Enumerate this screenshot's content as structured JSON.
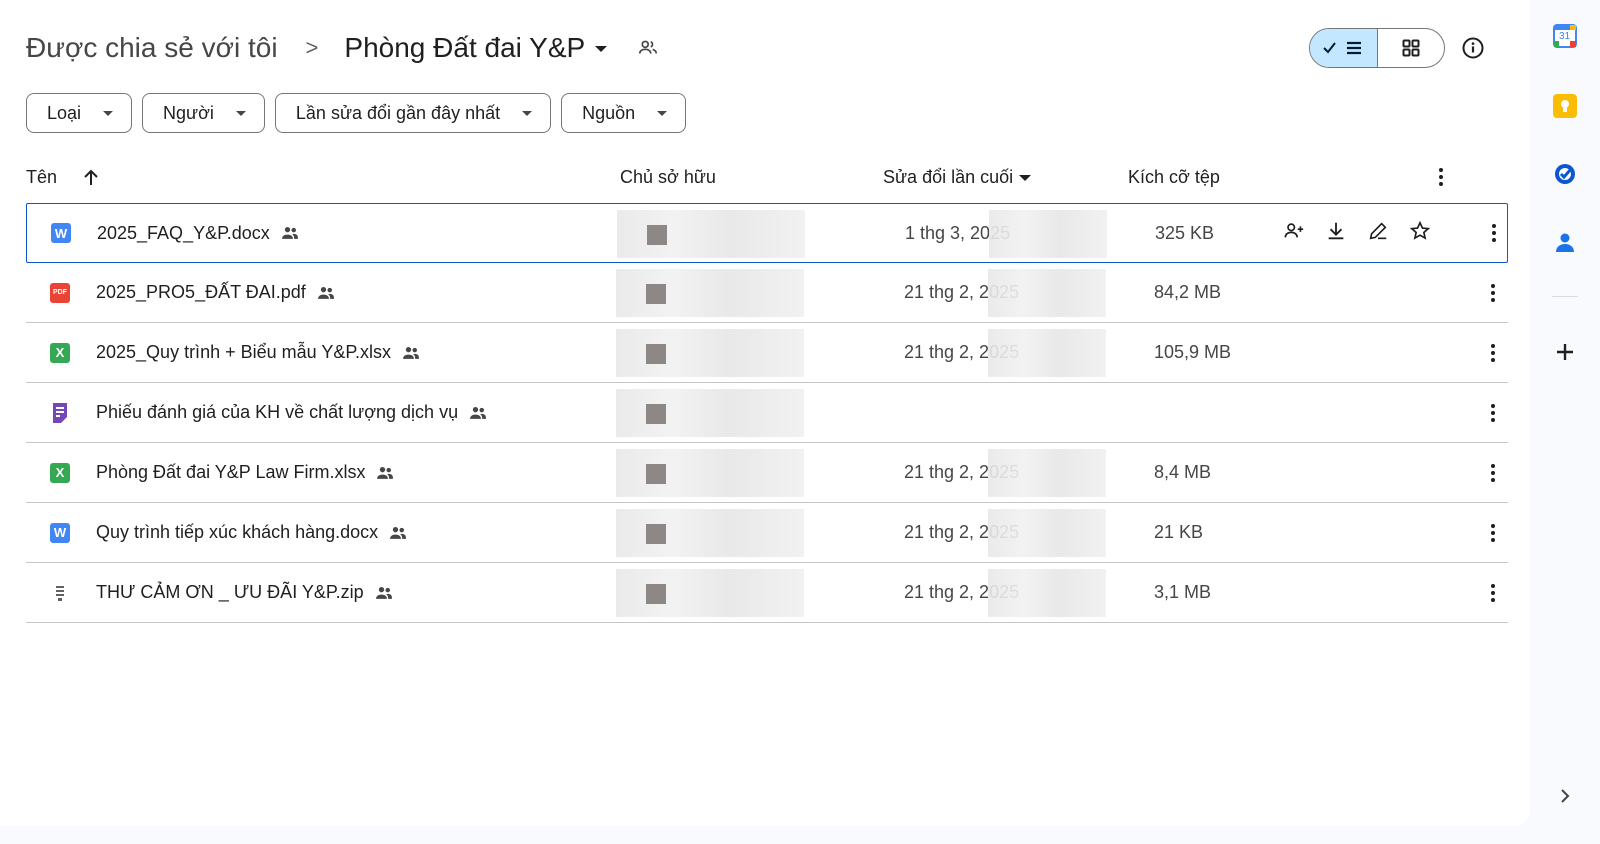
{
  "breadcrumb": {
    "root": "Được chia sẻ với tôi",
    "separator": ">",
    "current": "Phòng Đất đai Y&P"
  },
  "filters": [
    {
      "label": "Loại"
    },
    {
      "label": "Người"
    },
    {
      "label": "Lần sửa đổi gần đây nhất"
    },
    {
      "label": "Nguồn"
    }
  ],
  "table": {
    "headers": {
      "name": "Tên",
      "owner": "Chủ sở hữu",
      "modified": "Sửa đổi lần cuối",
      "size": "Kích cỡ tệp"
    },
    "rows": [
      {
        "icon": "word",
        "icon_text": "W",
        "name": "2025_FAQ_Y&P.docx",
        "date": "1 thg 3, 2025",
        "size": "325 KB",
        "selected": true
      },
      {
        "icon": "pdf",
        "icon_text": "PDF",
        "name": "2025_PRO5_ĐẤT ĐAI.pdf",
        "date": "21 thg 2, 2025",
        "size": "84,2 MB"
      },
      {
        "icon": "xls",
        "icon_text": "X",
        "name": "2025_Quy trình + Biểu mẫu Y&P.xlsx",
        "date": "21 thg 2, 2025",
        "size": "105,9 MB"
      },
      {
        "icon": "form",
        "icon_text": "",
        "name": "Phiếu đánh giá của KH về chất lượng dịch vụ",
        "date": "",
        "size": ""
      },
      {
        "icon": "xls",
        "icon_text": "X",
        "name": "Phòng Đất đai Y&P Law Firm.xlsx",
        "date": "21 thg 2, 2025",
        "size": "8,4 MB"
      },
      {
        "icon": "word",
        "icon_text": "W",
        "name": "Quy trình tiếp xúc khách hàng.docx",
        "date": "21 thg 2, 2025",
        "size": "21 KB"
      },
      {
        "icon": "zip",
        "icon_text": "",
        "name": "THƯ CẢM ƠN _ ƯU ĐÃI Y&P.zip",
        "date": "21 thg 2, 2025",
        "size": "3,1 MB"
      }
    ]
  },
  "colors": {
    "accent_blue": "#0b57d0",
    "toggle_active": "#c2e7ff",
    "word": "#4285f4",
    "pdf": "#ea4335",
    "sheets": "#34a853",
    "forms": "#7248b9"
  },
  "sidebar": {
    "apps": [
      "calendar-icon",
      "keep-icon",
      "tasks-icon",
      "contacts-icon",
      "add-icon"
    ],
    "calendar_day": "31"
  }
}
